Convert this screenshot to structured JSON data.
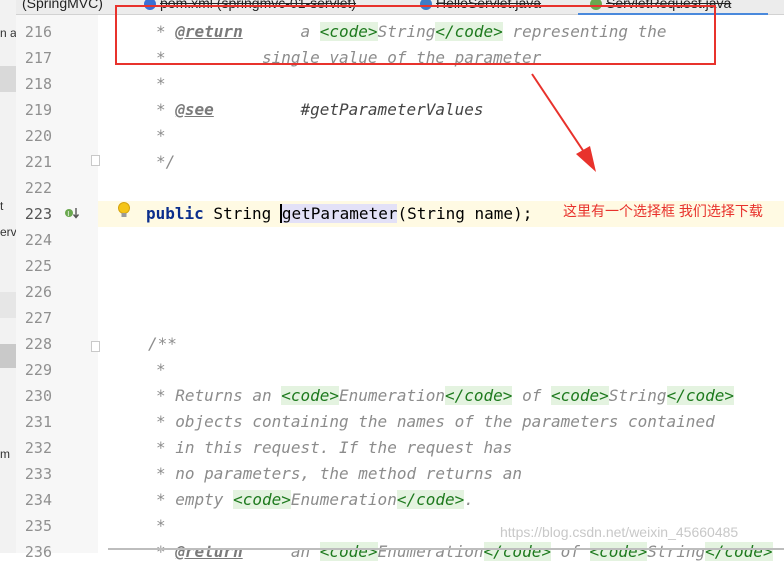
{
  "tabs": [
    {
      "label": "(SpringMVC)",
      "icon": "project-icon"
    },
    {
      "label": "pom.xml (springmvc-01-servlet)",
      "icon": "maven-file-icon"
    },
    {
      "label": "HelloServlet.java",
      "icon": "java-class-icon"
    },
    {
      "label": "ServletRequest.java",
      "icon": "java-interface-icon"
    }
  ],
  "left_fragments": [
    "n a",
    "t",
    "erv",
    "m"
  ],
  "line_numbers": [
    "216",
    "217",
    "218",
    "219",
    "220",
    "221",
    "222",
    "223",
    "224",
    "225",
    "226",
    "227",
    "228",
    "229",
    "230",
    "231",
    "232",
    "233",
    "234",
    "235",
    "236"
  ],
  "code": {
    "l216": {
      "star": "* ",
      "tag": "@return",
      "a": "      a ",
      "c1": "<code>",
      "t1": "String",
      "c2": "</code>",
      "rest": " representing the"
    },
    "l217": "*          single value of the parameter",
    "l218": "*",
    "l219": {
      "star": "* ",
      "tag": "@see",
      "rest": "         #getParameterValues"
    },
    "l220": "*",
    "l221": "*/",
    "l223": {
      "kw": "public",
      "type": " String ",
      "m1": "g",
      "m2": "etParameter",
      "rest": "(String name);"
    },
    "l228": "/**",
    "l229": "*",
    "l230": {
      "a": "* Returns an ",
      "c1": "<code>",
      "t1": "Enumeration",
      "c2": "</code>",
      "b": " of ",
      "c3": "<code>",
      "t2": "String",
      "c4": "</code>"
    },
    "l231": "* objects containing the names of the parameters contained",
    "l232": "* in this request. If the request has",
    "l233": "* no parameters, the method returns an",
    "l234": {
      "a": "* empty ",
      "c1": "<code>",
      "t1": "Enumeration",
      "c2": "</code>",
      "b": "."
    },
    "l235": "*",
    "l236": {
      "star": "* ",
      "tag": "@return",
      "a": "     an ",
      "c1": "<code>",
      "t1": "Enumeration",
      "c2": "</code>",
      "b": " of ",
      "c3": "<code>",
      "t2": "String",
      "c4": "</code>"
    }
  },
  "annotation_text": "这里有一个选择框 我们选择下载",
  "watermark": "https://blog.csdn.net/weixin_45660485",
  "colors": {
    "annotation": "#e8322c",
    "current_line": "#fffae3",
    "keyword": "#0b2e8c",
    "doc_tag_bg": "#e4f3e0"
  }
}
